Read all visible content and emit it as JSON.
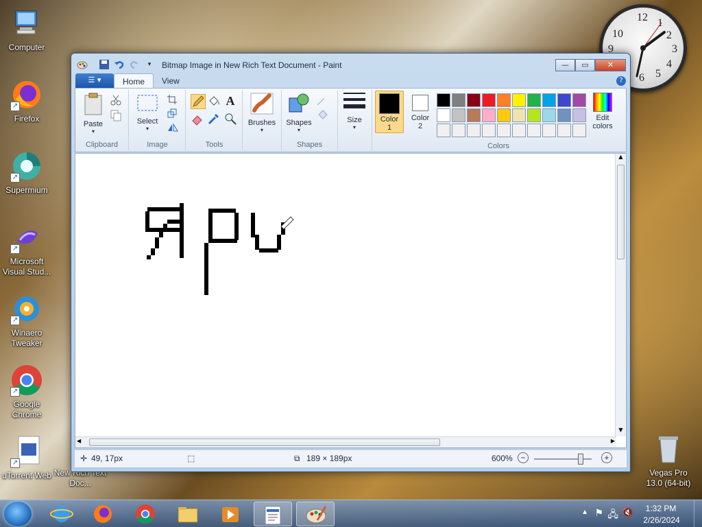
{
  "desktop": {
    "icons": [
      {
        "label": "Computer",
        "icon": "computer-icon"
      },
      {
        "label": "Firefox",
        "icon": "firefox-icon"
      },
      {
        "label": "Supermium",
        "icon": "supermium-icon"
      },
      {
        "label": "Microsoft Visual Stud...",
        "icon": "visual-studio-icon"
      },
      {
        "label": "Winaero Tweaker",
        "icon": "winaero-icon"
      },
      {
        "label": "Google Chrome",
        "icon": "chrome-icon"
      },
      {
        "label": "uTorrent Web",
        "icon": "utorrent-icon"
      },
      {
        "label": "New Rich Text Doc...",
        "icon": "rtf-document-icon"
      },
      {
        "label": "Vegas Pro 13.0 (64-bit)",
        "icon": "recycle-bin-icon"
      }
    ],
    "clock_numbers": [
      "12",
      "1",
      "2",
      "3",
      "4",
      "5",
      "6",
      "9",
      "10"
    ]
  },
  "window": {
    "title": "Bitmap Image in New Rich Text Document - Paint",
    "controls": {
      "minimize": "—",
      "maximize": "▭",
      "close": "✕"
    },
    "tabs": [
      {
        "label": "Home",
        "active": true
      },
      {
        "label": "View",
        "active": false
      }
    ],
    "ribbon": {
      "groups": {
        "clipboard": "Clipboard",
        "image": "Image",
        "tools": "Tools",
        "shapes": "Shapes",
        "colors": "Colors"
      },
      "buttons": {
        "paste": "Paste",
        "select": "Select",
        "brushes": "Brushes",
        "shapes": "Shapes",
        "size": "Size",
        "color1": "Color 1",
        "color2": "Color 2",
        "edit_colors": "Edit colors"
      },
      "color1": "#000000",
      "color2": "#ffffff",
      "palette": [
        "#000000",
        "#7f7f7f",
        "#880015",
        "#ed1c24",
        "#ff7f27",
        "#fff200",
        "#22b14c",
        "#00a2e8",
        "#3f48cc",
        "#a349a4",
        "#ffffff",
        "#c3c3c3",
        "#b97a57",
        "#ffaec9",
        "#ffc90e",
        "#efe4b0",
        "#b5e61d",
        "#99d9ea",
        "#7092be",
        "#c8bfe7",
        "#f0f0f0",
        "#f0f0f0",
        "#f0f0f0",
        "#f0f0f0",
        "#f0f0f0",
        "#f0f0f0",
        "#f0f0f0",
        "#f0f0f0",
        "#f0f0f0",
        "#f0f0f0"
      ]
    },
    "status": {
      "cursor": "49, 17px",
      "image_size": "189 × 189px",
      "zoom": "600%"
    }
  },
  "taskbar": {
    "time": "1:32 PM",
    "date": "2/26/2024",
    "pinned": [
      "internet-explorer-icon",
      "firefox-icon",
      "chrome-icon",
      "explorer-icon",
      "media-player-icon",
      "wordpad-icon",
      "paint-icon"
    ]
  }
}
